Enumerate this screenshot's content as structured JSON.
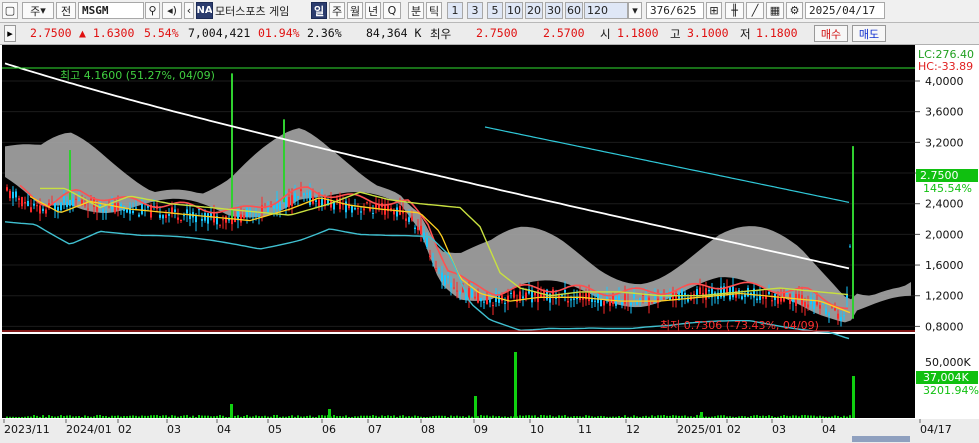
{
  "toolbar": {
    "market_type": "주",
    "exchange": "전",
    "ticker": "MSGM",
    "na_badge": "NA",
    "stock_name": "모터스포츠 게임",
    "periods": [
      "일",
      "주",
      "월",
      "년",
      "Q",
      "분",
      "틱"
    ],
    "intervals": [
      "1",
      "3",
      "5",
      "10",
      "20",
      "30",
      "60",
      "120"
    ],
    "page_counter": "376/625",
    "date": "2025/04/17"
  },
  "quote": {
    "price": "2.7500",
    "change": "▲ 1.6300",
    "change_pct": "5.54%",
    "volume": "7,004,421",
    "volume_ratio": "01.94%",
    "turnover": "2.36%",
    "amount": "84,364 K",
    "best_label": "최우",
    "ask": "2.7500",
    "bid": "2.5700",
    "open_label": "시",
    "open": "1.1800",
    "high_label": "고",
    "high": "3.1000",
    "low_label": "저",
    "low": "1.1800",
    "buy_label": "매수",
    "sell_label": "매도"
  },
  "colors": {
    "up": "#ff2a2a",
    "down": "#18c8ff",
    "background": "#000000",
    "ma5": "#ff5050",
    "ma20": "#ffd020",
    "ma60": "#c8e040",
    "ma120": "#ffffff",
    "ma240": "#40c0d0",
    "cloud": "#a0a0a0",
    "volume_up": "#10d010",
    "current_price_bg": "#10c010"
  },
  "chart_data": {
    "type": "candlestick",
    "price_axis": {
      "ticks": [
        4.0,
        3.6,
        3.2,
        2.8,
        2.4,
        2.0,
        1.6,
        1.2,
        0.8
      ],
      "labels": [
        "4,0000",
        "3,6000",
        "3,2000",
        "2,8000",
        "2,4000",
        "2,0000",
        "1,6000",
        "1,2000",
        "0,8000"
      ]
    },
    "lc_label": "LC:276.40",
    "hc_label": "HC:-33.89",
    "current_price_tag": "2.7500",
    "current_pct_tag": "145.54%",
    "max_annotation": "최고 4.1600 (51.27%, 04/09)",
    "min_annotation": "최저 0.7306 (-73.43%, 04/09)",
    "volume_axis": {
      "top_label": "50,000K",
      "current_label": "37,004K",
      "pct_label": "3201.94%"
    },
    "x_labels": [
      "2023/11",
      "2024/01",
      "02",
      "03",
      "04",
      "05",
      "06",
      "07",
      "08",
      "09",
      "10",
      "11",
      "12",
      "2025/01",
      "02",
      "03",
      "04",
      "04/17"
    ]
  }
}
